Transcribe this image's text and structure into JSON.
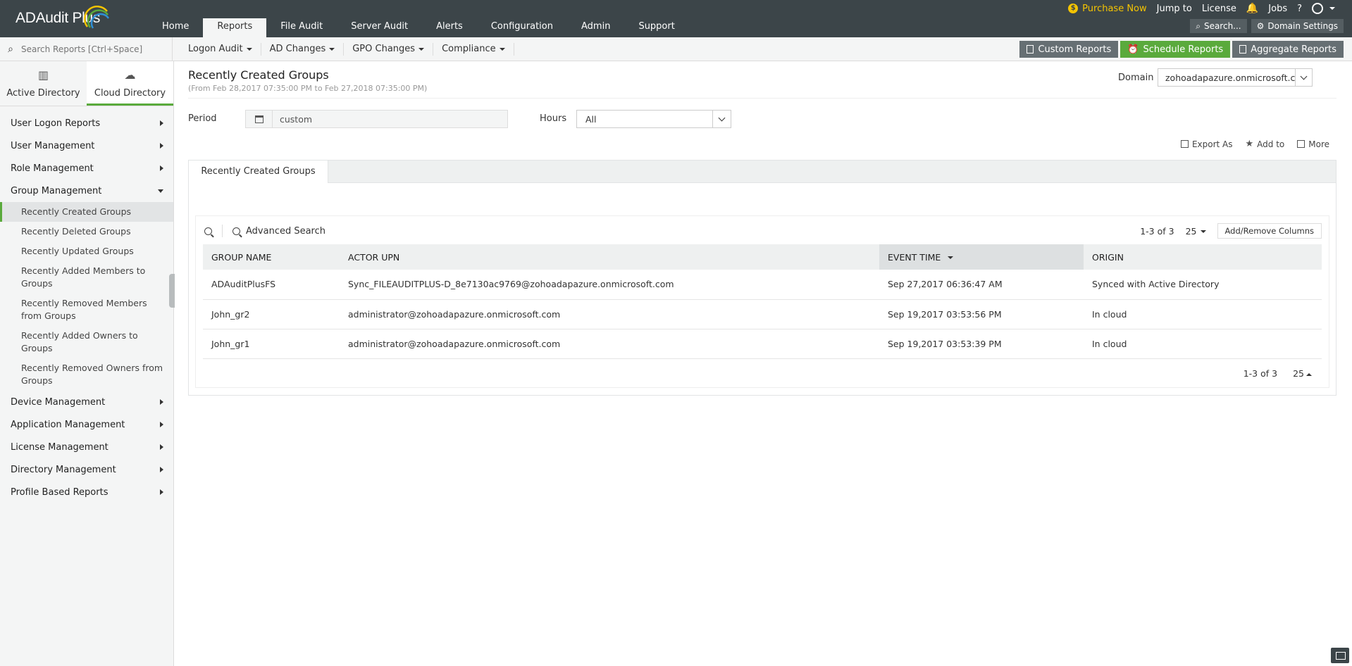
{
  "app": {
    "logo": "ADAudit Plus"
  },
  "main_nav": [
    "Home",
    "Reports",
    "File Audit",
    "Server Audit",
    "Alerts",
    "Configuration",
    "Admin",
    "Support"
  ],
  "main_nav_active": "Reports",
  "top_links": {
    "purchase": "Purchase Now",
    "jump": "Jump to",
    "license": "License",
    "jobs": "Jobs",
    "help": "?"
  },
  "top_tools": {
    "search": "Search...",
    "domain_settings": "Domain Settings"
  },
  "search": {
    "placeholder": "Search Reports [Ctrl+Space]"
  },
  "sub_nav": [
    "Logon Audit",
    "AD Changes",
    "GPO Changes",
    "Compliance"
  ],
  "report_buttons": {
    "custom": "Custom Reports",
    "schedule": "Schedule Reports",
    "aggregate": "Aggregate Reports"
  },
  "dir_tabs": {
    "ad": "Active Directory",
    "cloud": "Cloud Directory"
  },
  "menu": {
    "user_logon": "User Logon Reports",
    "user_mgmt": "User Management",
    "role_mgmt": "Role Management",
    "group_mgmt": "Group Management",
    "group_items": [
      "Recently Created Groups",
      "Recently Deleted Groups",
      "Recently Updated Groups",
      "Recently Added Members to Groups",
      "Recently Removed Members from Groups",
      "Recently Added Owners to Groups",
      "Recently Removed Owners from Groups"
    ],
    "device_mgmt": "Device Management",
    "app_mgmt": "Application Management",
    "license_mgmt": "License Management",
    "dir_mgmt": "Directory Management",
    "profile": "Profile Based Reports"
  },
  "page": {
    "title": "Recently Created Groups",
    "range": "(From Feb 28,2017 07:35:00 PM to Feb 27,2018 07:35:00 PM)",
    "domain_label": "Domain",
    "domain_value": "zohoadapazure.onmicrosoft.com",
    "period_label": "Period",
    "period_value": "custom",
    "hours_label": "Hours",
    "hours_value": "All",
    "export": "Export As",
    "add_to": "Add to",
    "more": "More",
    "tab": "Recently Created Groups",
    "advanced_search": "Advanced Search",
    "count": "1-3 of 3",
    "per_page": "25",
    "add_remove_cols": "Add/Remove Columns"
  },
  "table": {
    "headers": [
      "GROUP NAME",
      "ACTOR UPN",
      "EVENT TIME",
      "ORIGIN"
    ],
    "rows": [
      [
        "ADAuditPlusFS",
        "Sync_FILEAUDITPLUS-D_8e7130ac9769@zohoadapazure.onmicrosoft.com",
        "Sep 27,2017 06:36:47 AM",
        "Synced with Active Directory"
      ],
      [
        "John_gr2",
        "administrator@zohoadapazure.onmicrosoft.com",
        "Sep 19,2017 03:53:56 PM",
        "In cloud"
      ],
      [
        "John_gr1",
        "administrator@zohoadapazure.onmicrosoft.com",
        "Sep 19,2017 03:53:39 PM",
        "In cloud"
      ]
    ]
  },
  "colors": {
    "accent": "#5aaa3c",
    "topbar": "#3c4549",
    "purchase": "#f5c400"
  }
}
